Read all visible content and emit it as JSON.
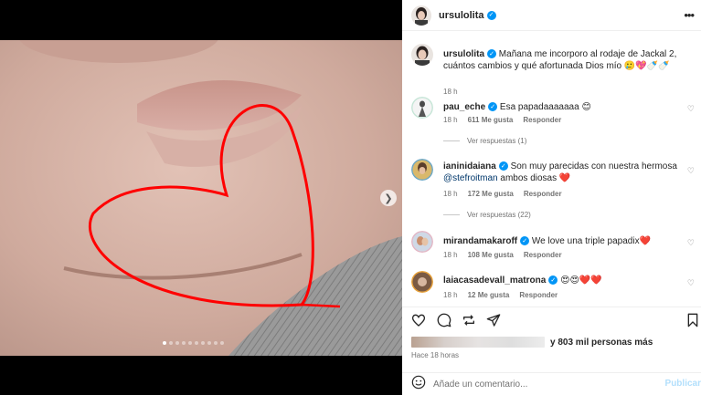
{
  "post": {
    "username": "ursulolita",
    "verified_icon": "verified-badge-icon",
    "caption_user": "ursulolita",
    "caption": "Mañana me incorporo al rodaje de Jackal 2, cuántos cambios y qué afortunada Dios mío 🥲💖🍼🍼",
    "caption_time": "18 h",
    "more_icon": "more-options-icon",
    "carousel_dots": 10,
    "carousel_active_index": 0
  },
  "comments": [
    {
      "user": "pau_eche",
      "text": "Esa papadaaaaaaa 😊",
      "time": "18 h",
      "likes": "611 Me gusta",
      "reply": "Responder",
      "view_replies": "Ver respuestas (1)"
    },
    {
      "user": "ianinidaiana",
      "text": "Son muy parecidas con nuestra hermosa",
      "mention": "@stefroitman",
      "text2": "ambos diosas ❤️",
      "time": "18 h",
      "likes": "172 Me gusta",
      "reply": "Responder",
      "view_replies": "Ver respuestas (22)"
    },
    {
      "user": "mirandamakaroff",
      "text": "We love una triple papadix❤️",
      "time": "18 h",
      "likes": "108 Me gusta",
      "reply": "Responder"
    },
    {
      "user": "laiacasadevall_matrona",
      "text": "😍😍❤️❤️",
      "time": "18 h",
      "likes": "12 Me gusta",
      "reply": "Responder"
    }
  ],
  "likes_summary": "y 803 mil personas más",
  "posted_time": "Hace 18 horas",
  "add_comment": {
    "placeholder": "Añade un comentario...",
    "publish": "Publicar"
  },
  "colors": {
    "accent": "#0095f6",
    "heart_stroke": "#ff0000"
  }
}
